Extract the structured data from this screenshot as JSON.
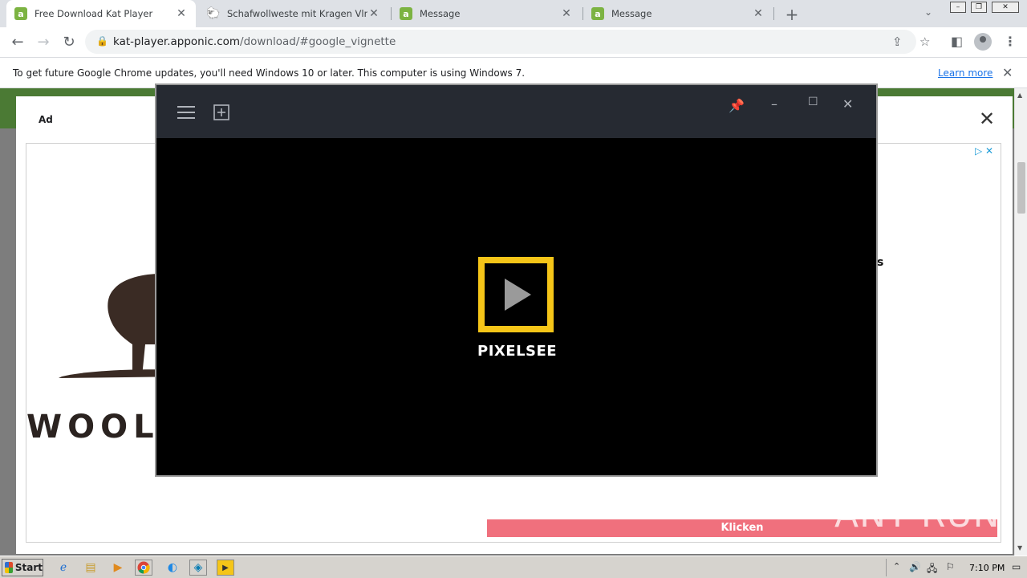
{
  "tabs": [
    {
      "title": "Free Download Kat Player",
      "favicon": "apponic-icon",
      "active": true
    },
    {
      "title": "Schafwollweste mit Kragen Vlnka - W",
      "favicon": "sheep-icon",
      "active": false
    },
    {
      "title": "Message",
      "favicon": "apponic-icon",
      "active": false
    },
    {
      "title": "Message",
      "favicon": "apponic-icon",
      "active": false
    }
  ],
  "address_bar": {
    "host": "kat-player.apponic.com",
    "path": "/download/#google_vignette"
  },
  "info_bar": {
    "message": "To get future Google Chrome updates, you'll need Windows 10 or later. This computer is using Windows 7.",
    "link": "Learn more"
  },
  "ad": {
    "label": "Ad",
    "brand": "WOOLV",
    "partial_letter": "s",
    "cta": "Klicken"
  },
  "player": {
    "logo_text": "PIXELSEE",
    "accent_color": "#f5c518"
  },
  "watermark": "ANY RUN",
  "taskbar": {
    "start_label": "Start",
    "clock": "7:10 PM"
  }
}
